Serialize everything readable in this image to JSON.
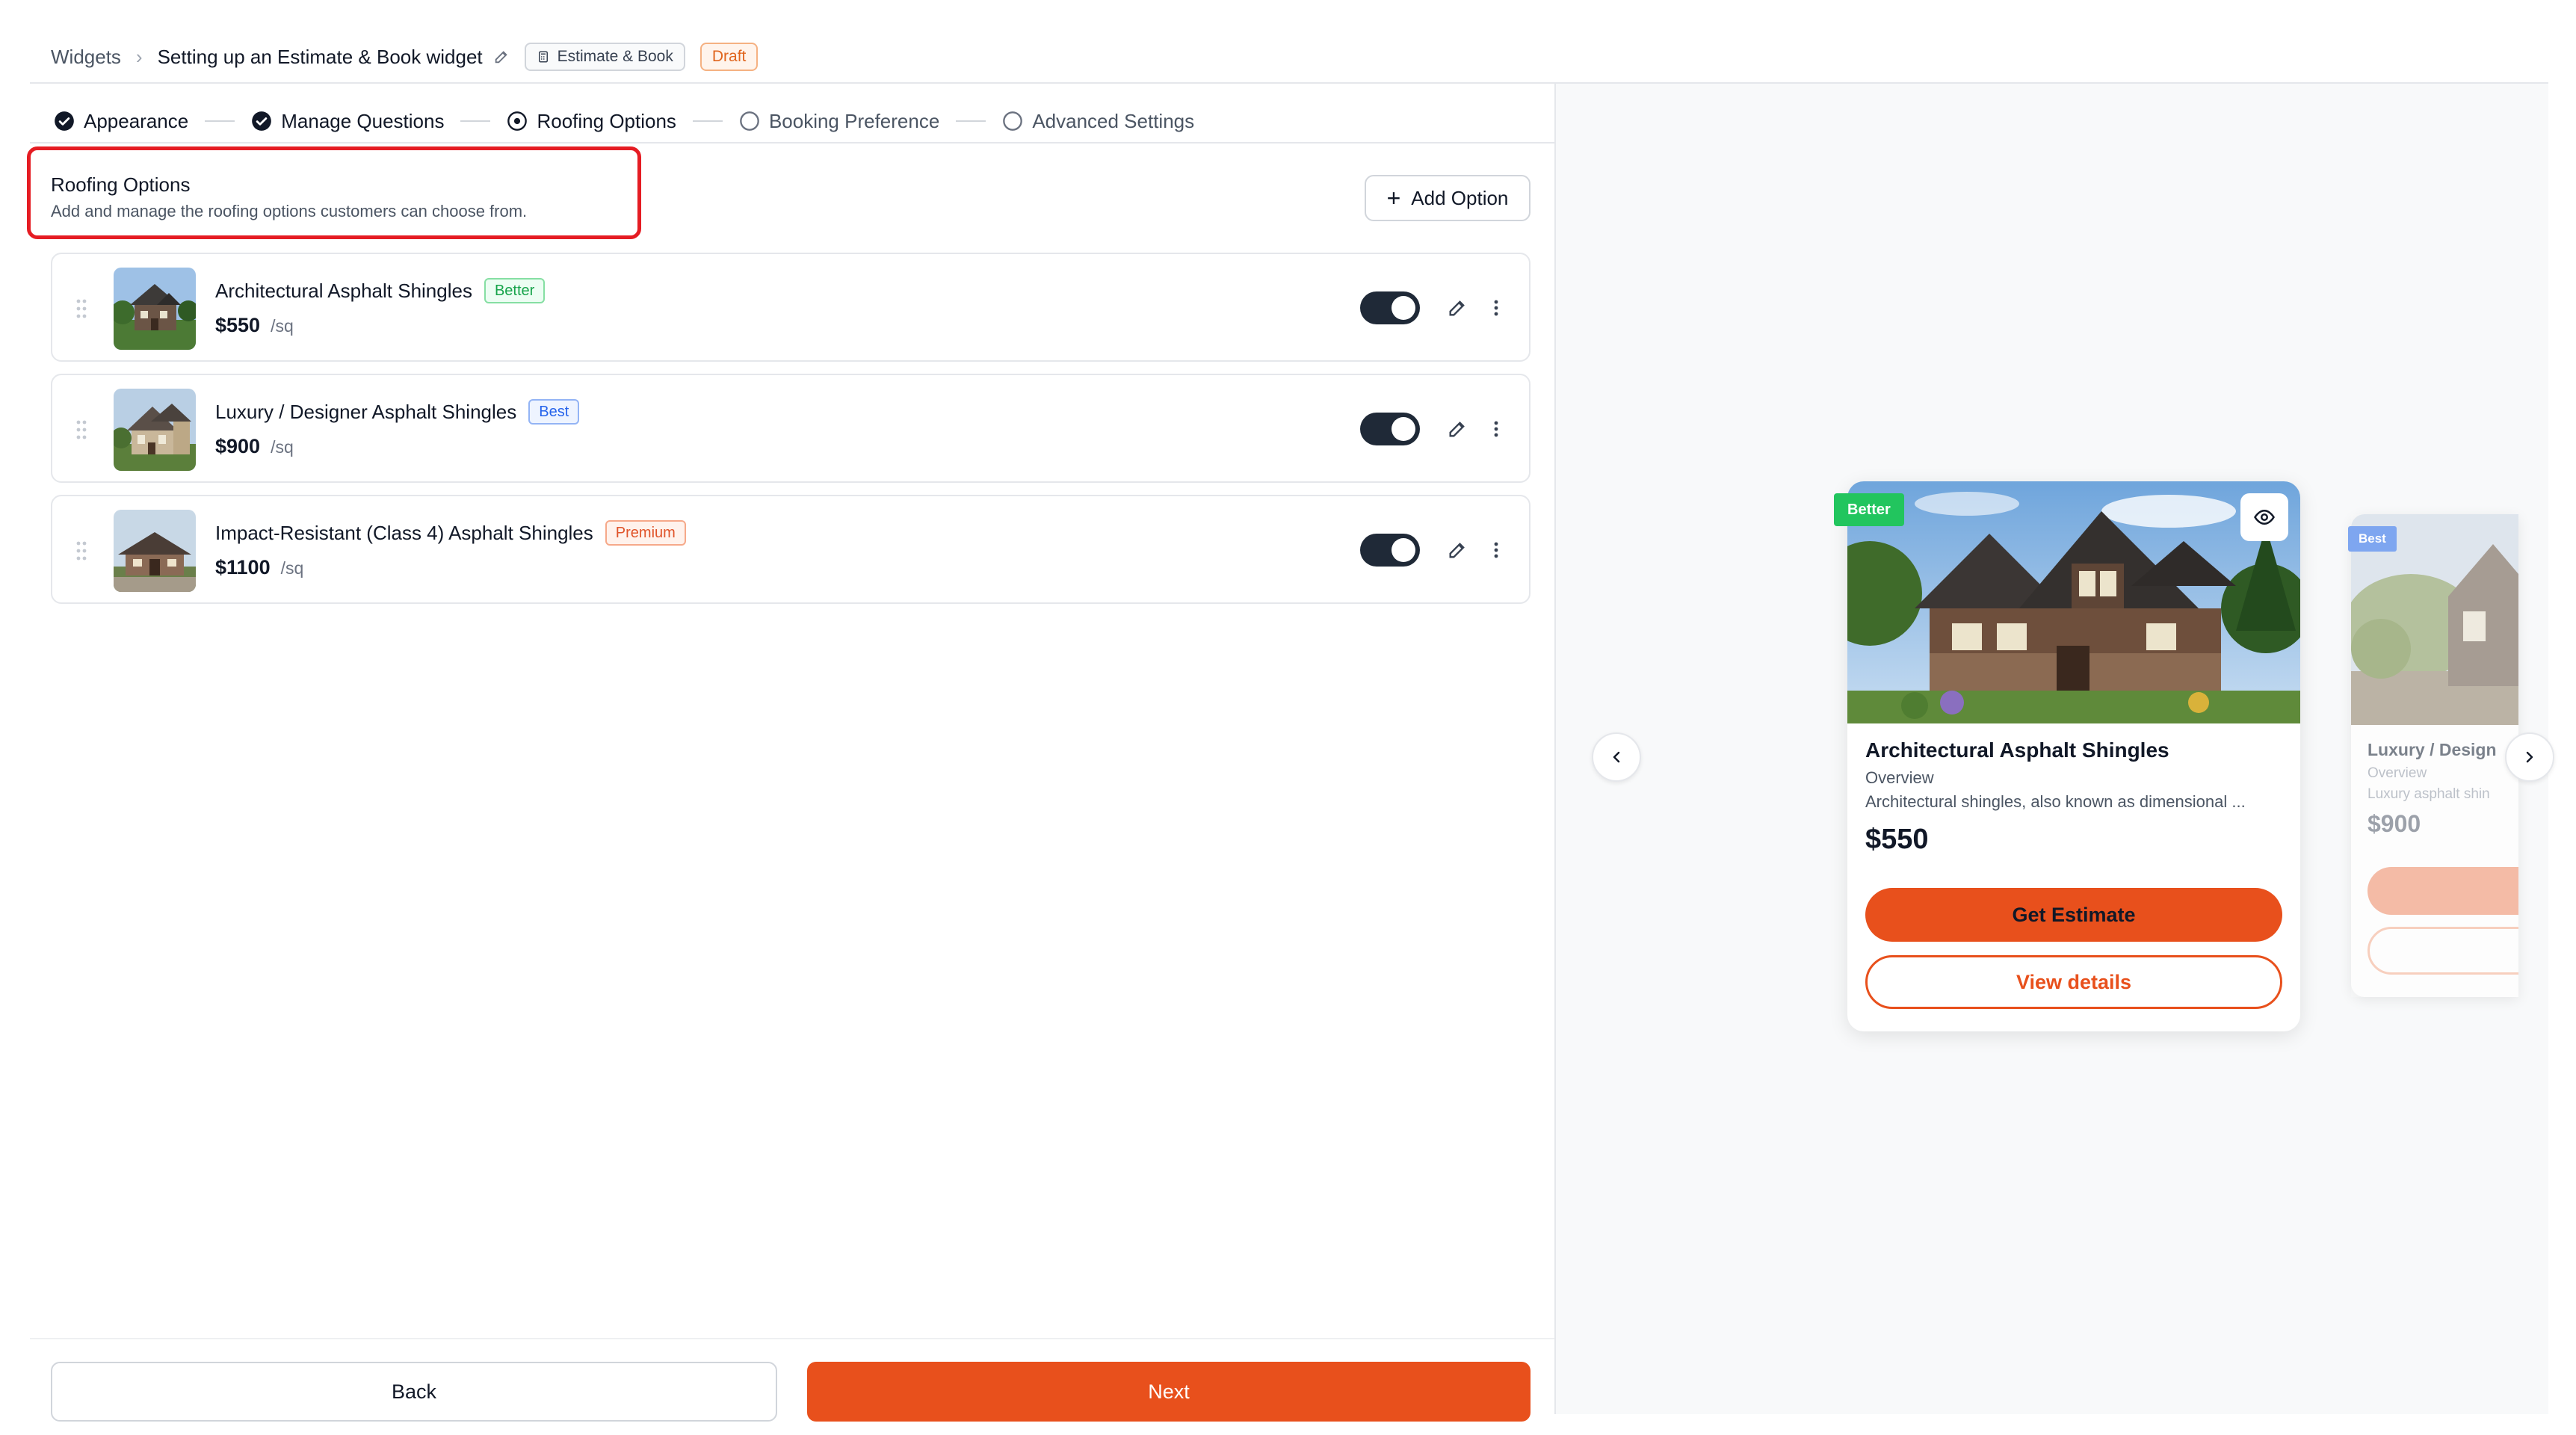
{
  "breadcrumb": {
    "root": "Widgets",
    "separator": "›",
    "title": "Setting up an Estimate & Book widget",
    "mode_chip": "Estimate & Book",
    "status_chip": "Draft"
  },
  "steps": [
    {
      "label": "Appearance",
      "state": "done"
    },
    {
      "label": "Manage Questions",
      "state": "done"
    },
    {
      "label": "Roofing Options",
      "state": "current"
    },
    {
      "label": "Booking Preference",
      "state": "todo"
    },
    {
      "label": "Advanced Settings",
      "state": "todo"
    }
  ],
  "section": {
    "title": "Roofing Options",
    "subtitle": "Add and manage the roofing options customers can choose from.",
    "add_button": "Add Option"
  },
  "options": [
    {
      "name": "Architectural Asphalt Shingles",
      "badge": "Better",
      "price": "$550",
      "unit": "/sq",
      "enabled": true
    },
    {
      "name": "Luxury / Designer Asphalt Shingles",
      "badge": "Best",
      "price": "$900",
      "unit": "/sq",
      "enabled": true
    },
    {
      "name": "Impact-Resistant (Class 4) Asphalt Shingles",
      "badge": "Premium",
      "price": "$1100",
      "unit": "/sq",
      "enabled": true
    }
  ],
  "footer": {
    "back": "Back",
    "next": "Next"
  },
  "preview": {
    "main_card": {
      "ribbon": "Better",
      "title": "Architectural Asphalt Shingles",
      "overview": "Overview",
      "description": "Architectural shingles, also known as dimensional ...",
      "price": "$550",
      "cta": "Get Estimate",
      "secondary": "View details"
    },
    "next_card": {
      "ribbon": "Best",
      "title": "Luxury / Design",
      "overview": "Overview",
      "description": "Luxury asphalt shin",
      "price": "$900"
    }
  },
  "colors": {
    "accent": "#e8501c",
    "better": "#22c55e",
    "best": "#7ea6f0",
    "premium": "#e0542a",
    "toggle_on": "#1f2937",
    "highlight_box": "#e51c23"
  }
}
